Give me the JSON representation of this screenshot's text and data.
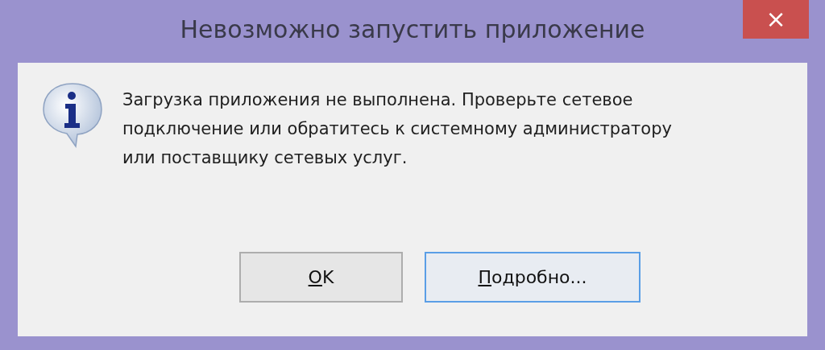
{
  "window": {
    "title": "Невозможно запустить приложение",
    "close_button": "×"
  },
  "message": "Загрузка приложения не выполнена. Проверьте сетевое подключение или обратитесь к системному администратору или поставщику сетевых услуг.",
  "buttons": [
    {
      "label": "OK",
      "focused": false
    },
    {
      "label": "Подробно...",
      "focused": true
    }
  ]
}
